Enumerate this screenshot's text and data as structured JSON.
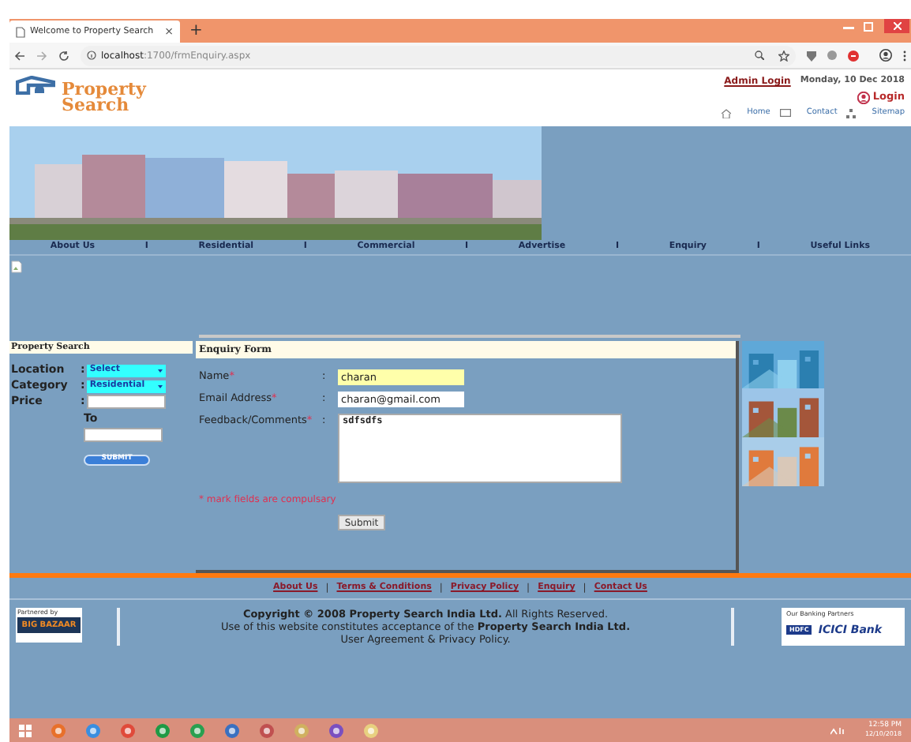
{
  "browser": {
    "tab_title": "Welcome to Property Search",
    "tab_close": "×",
    "new_tab": "+",
    "url_host": "localhost",
    "url_path": ":1700/frmEnquiry.aspx"
  },
  "header": {
    "logo_lines": [
      "Property",
      "Search"
    ],
    "admin_login": "Admin Login",
    "date": "Monday, 10 Dec 2018",
    "login": "Login",
    "links": [
      "Home",
      "Contact",
      "Sitemap"
    ]
  },
  "nav": {
    "separators": [
      "I",
      "I",
      "I",
      "I",
      "I"
    ],
    "items": [
      "About Us",
      "Residential",
      "Commercial",
      "Advertise",
      "Enquiry",
      "Useful Links"
    ]
  },
  "property_search": {
    "title": "Property Search",
    "fields": [
      {
        "kind": "select",
        "label": "Location",
        "separator": ":",
        "value": "Select"
      },
      {
        "kind": "select",
        "label": "Category",
        "separator": ":",
        "value": "Residential"
      },
      {
        "kind": "input",
        "label": "Price",
        "separator": ":"
      },
      {
        "kind": "input_below",
        "label": "To"
      }
    ],
    "submit": "SUBMIT"
  },
  "enquiry_form": {
    "title": "Enquiry Form",
    "fields": [
      {
        "kind": "input",
        "label": "Name",
        "required_mark": "*",
        "separator": ":",
        "value": "charan",
        "highlighted": true
      },
      {
        "kind": "input",
        "label": "Email Address",
        "required_mark": "*",
        "separator": ":",
        "value": "charan@gmail.com",
        "highlighted": false
      },
      {
        "kind": "textarea",
        "label": "Feedback/Comments",
        "required_mark": "*",
        "separator": ":",
        "value": "sdfsdfs",
        "highlighted": false
      }
    ],
    "note": "* mark fields are compulsary",
    "submit": "Submit"
  },
  "footer": {
    "separators": [
      "|",
      "|",
      "|",
      "|"
    ],
    "links": [
      "About Us",
      "Terms & Conditions",
      "Privacy Policy",
      "Enquiry",
      "Contact Us"
    ],
    "lines": [
      "**Copyright © 2008 Property Search India Ltd.** All Rights Reserved.",
      "Use of this website constitutes acceptance of the **Property Search India Ltd.**",
      "User Agreement & Privacy Policy."
    ],
    "partner_label": "Partnered by",
    "partner_name": "BIG BAZAAR",
    "banking_label": "Our Banking Partners",
    "banks": [
      "HDFC",
      "ICICI Bank"
    ]
  },
  "taskbar": {
    "time": "12:58 PM",
    "date": "12/10/2018"
  }
}
